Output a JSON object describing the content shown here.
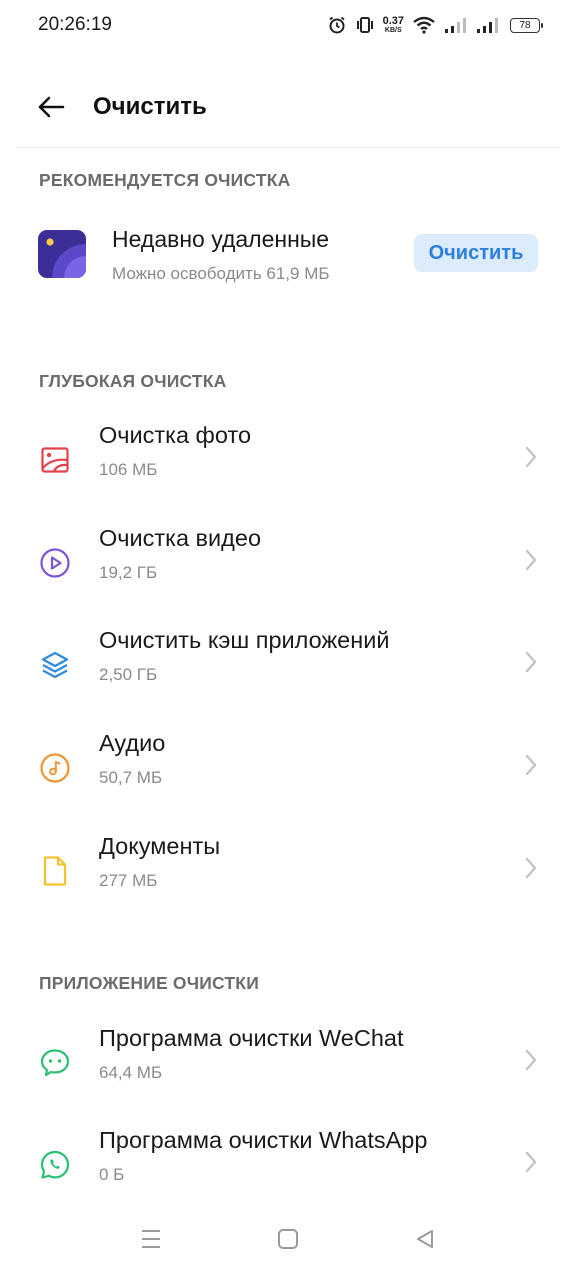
{
  "status_bar": {
    "time": "20:26:19",
    "net_speed_value": "0.37",
    "net_speed_unit": "KB/S",
    "battery": "78",
    "icons": [
      "alarm-icon",
      "vibrate-icon",
      "wifi-icon",
      "signal-icon",
      "signal-icon",
      "battery-icon"
    ]
  },
  "header": {
    "title": "Очистить",
    "back_icon": "arrow-left-icon"
  },
  "sections": {
    "recommended": "РЕКОМЕНДУЕТСЯ ОЧИСТКА",
    "deep": "ГЛУБОКАЯ ОЧИСТКА",
    "apps": "ПРИЛОЖЕНИЕ ОЧИСТКИ"
  },
  "recommended_item": {
    "title": "Недавно удаленные",
    "subtitle": "Можно освободить 61,9 МБ",
    "button_label": "Очистить",
    "icon": "recently-deleted-icon"
  },
  "deep_items": [
    {
      "title": "Очистка фото",
      "size": "106 МБ",
      "icon": "photo-icon",
      "color": "#e2434b"
    },
    {
      "title": "Очистка видео",
      "size": "19,2 ГБ",
      "icon": "video-play-icon",
      "color": "#7c55d6"
    },
    {
      "title": "Очистить кэш приложений",
      "size": "2,50 ГБ",
      "icon": "layers-icon",
      "color": "#2d8ae0"
    },
    {
      "title": "Аудио",
      "size": "50,7 МБ",
      "icon": "music-note-icon",
      "color": "#ef9433"
    },
    {
      "title": "Документы",
      "size": "277 МБ",
      "icon": "document-icon",
      "color": "#f2c230"
    }
  ],
  "app_items": [
    {
      "title": "Программа очистки WeChat",
      "size": "64,4 МБ",
      "icon": "wechat-icon",
      "color": "#2bc076"
    },
    {
      "title": "Программа очистки WhatsApp",
      "size": "0 Б",
      "icon": "whatsapp-icon",
      "color": "#2bc076"
    }
  ],
  "nav_bar": {
    "icons": [
      "menu-icon",
      "home-square-icon",
      "back-triangle-icon"
    ]
  }
}
